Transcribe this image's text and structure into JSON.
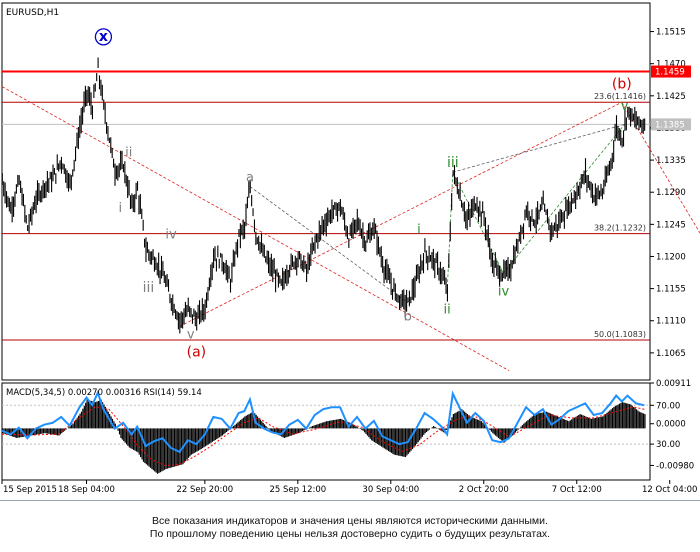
{
  "chart_data": {
    "type": "line",
    "symbol": "EURUSD,H1",
    "price_axis": {
      "ylim": [
        1.1027,
        1.1555
      ],
      "ticks": [
        "1.1515",
        "1.1470",
        "1.1425",
        "1.1380",
        "1.1335",
        "1.1290",
        "1.1245",
        "1.1200",
        "1.1155",
        "1.1110",
        "1.1065"
      ],
      "tick_values": [
        1.1515,
        1.147,
        1.1425,
        1.138,
        1.1335,
        1.129,
        1.1245,
        1.12,
        1.1155,
        1.111,
        1.1065
      ],
      "marked_levels": [
        {
          "label": "1.1459",
          "value": 1.1459,
          "color": "#ff0000"
        },
        {
          "label": "1.1385",
          "value": 1.1385,
          "color": "#c0c0c0"
        }
      ]
    },
    "time_axis": {
      "labels": [
        "15 Sep 2015",
        "18 Sep 04:00",
        "22 Sep 20:00",
        "25 Sep 12:00",
        "30 Sep 04:00",
        "2 Oct 20:00",
        "7 Oct 12:00",
        "12 Oct 04:00"
      ],
      "label_bars": [
        0,
        60,
        144,
        210,
        276,
        342,
        408,
        474
      ]
    },
    "price_series": {
      "name": "EURUSD",
      "pivots": [
        [
          0,
          1.1305
        ],
        [
          6,
          1.1265
        ],
        [
          12,
          1.1305
        ],
        [
          18,
          1.124
        ],
        [
          24,
          1.128
        ],
        [
          30,
          1.13
        ],
        [
          36,
          1.131
        ],
        [
          42,
          1.1335
        ],
        [
          48,
          1.13
        ],
        [
          55,
          1.138
        ],
        [
          60,
          1.143
        ],
        [
          64,
          1.1408
        ],
        [
          68,
          1.1462
        ],
        [
          72,
          1.141
        ],
        [
          76,
          1.1365
        ],
        [
          80,
          1.132
        ],
        [
          86,
          1.1328
        ],
        [
          92,
          1.127
        ],
        [
          96,
          1.1295
        ],
        [
          102,
          1.121
        ],
        [
          108,
          1.1195
        ],
        [
          114,
          1.1175
        ],
        [
          120,
          1.114
        ],
        [
          126,
          1.111
        ],
        [
          132,
          1.1125
        ],
        [
          138,
          1.1112
        ],
        [
          144,
          1.1128
        ],
        [
          150,
          1.12
        ],
        [
          156,
          1.1195
        ],
        [
          162,
          1.1165
        ],
        [
          168,
          1.123
        ],
        [
          172,
          1.124
        ],
        [
          176,
          1.1298
        ],
        [
          180,
          1.1232
        ],
        [
          186,
          1.12
        ],
        [
          192,
          1.118
        ],
        [
          198,
          1.116
        ],
        [
          204,
          1.1185
        ],
        [
          210,
          1.12
        ],
        [
          216,
          1.118
        ],
        [
          222,
          1.122
        ],
        [
          228,
          1.1245
        ],
        [
          234,
          1.1262
        ],
        [
          240,
          1.127
        ],
        [
          246,
          1.1225
        ],
        [
          252,
          1.125
        ],
        [
          258,
          1.122
        ],
        [
          264,
          1.124
        ],
        [
          270,
          1.119
        ],
        [
          276,
          1.116
        ],
        [
          282,
          1.114
        ],
        [
          288,
          1.1135
        ],
        [
          294,
          1.1165
        ],
        [
          300,
          1.1205
        ],
        [
          306,
          1.1195
        ],
        [
          312,
          1.1175
        ],
        [
          316,
          1.115
        ],
        [
          320,
          1.1318
        ],
        [
          324,
          1.1292
        ],
        [
          330,
          1.125
        ],
        [
          336,
          1.1275
        ],
        [
          342,
          1.1255
        ],
        [
          348,
          1.119
        ],
        [
          354,
          1.1175
        ],
        [
          360,
          1.118
        ],
        [
          366,
          1.1215
        ],
        [
          372,
          1.1265
        ],
        [
          378,
          1.125
        ],
        [
          384,
          1.127
        ],
        [
          390,
          1.1235
        ],
        [
          396,
          1.125
        ],
        [
          402,
          1.127
        ],
        [
          408,
          1.129
        ],
        [
          414,
          1.1315
        ],
        [
          420,
          1.1285
        ],
        [
          426,
          1.129
        ],
        [
          432,
          1.133
        ],
        [
          436,
          1.138
        ],
        [
          440,
          1.1365
        ],
        [
          444,
          1.1405
        ],
        [
          450,
          1.1388
        ],
        [
          456,
          1.1385
        ]
      ]
    },
    "fib_levels": [
      {
        "label": "23.6(1.1416)",
        "value": 1.1416,
        "color": "#b30000"
      },
      {
        "label": "38.2(1.1232)",
        "value": 1.1232,
        "color": "#b30000"
      },
      {
        "label": "50.0(1.1083)",
        "value": 1.1083,
        "color": "#b30000"
      }
    ],
    "wave_labels": [
      {
        "text": "x",
        "bar": 72,
        "price": 1.1502,
        "color": "#0000cc",
        "circled": true
      },
      {
        "text": "ii",
        "bar": 90,
        "price": 1.134,
        "color": "#808080"
      },
      {
        "text": "i",
        "bar": 84,
        "price": 1.1262,
        "color": "#808080"
      },
      {
        "text": "iv",
        "bar": 120,
        "price": 1.1225,
        "color": "#808080"
      },
      {
        "text": "iii",
        "bar": 104,
        "price": 1.115,
        "color": "#808080"
      },
      {
        "text": "v",
        "bar": 134,
        "price": 1.1085,
        "color": "#808080"
      },
      {
        "text": "(a)",
        "bar": 138,
        "price": 1.106,
        "color": "#cc0000"
      },
      {
        "text": "a",
        "bar": 176,
        "price": 1.1305,
        "color": "#808080"
      },
      {
        "text": "b",
        "bar": 288,
        "price": 1.111,
        "color": "#808080"
      },
      {
        "text": "i",
        "bar": 296,
        "price": 1.1232,
        "color": "#2e8b2e"
      },
      {
        "text": "ii",
        "bar": 316,
        "price": 1.112,
        "color": "#2e8b2e"
      },
      {
        "text": "iii",
        "bar": 320,
        "price": 1.1325,
        "color": "#2e8b2e"
      },
      {
        "text": "iv",
        "bar": 356,
        "price": 1.1145,
        "color": "#2e8b2e"
      },
      {
        "text": "v",
        "bar": 442,
        "price": 1.1405,
        "color": "#2e8b2e"
      },
      {
        "text": "(b)",
        "bar": 440,
        "price": 1.1435,
        "color": "#cc0000"
      }
    ],
    "indicator": {
      "label": "MACD(5,34,5) 0.00270 0.00316 RSI(14) 59.14",
      "ticks": [
        "0.00911",
        "70.00",
        "0.0000",
        "30.00",
        "-0.00980"
      ],
      "tick_positions": [
        0.0,
        0.23,
        0.42,
        0.63,
        0.85
      ],
      "ylim": [
        -0.0108,
        0.0095
      ],
      "histogram": [
        [
          0,
          -0.001
        ],
        [
          10,
          -0.002
        ],
        [
          20,
          -0.0015
        ],
        [
          30,
          -0.001
        ],
        [
          40,
          -0.0015
        ],
        [
          50,
          0.001
        ],
        [
          56,
          0.0035
        ],
        [
          60,
          0.006
        ],
        [
          66,
          0.0055
        ],
        [
          70,
          0.006
        ],
        [
          74,
          0.004
        ],
        [
          80,
          0.001
        ],
        [
          84,
          -0.002
        ],
        [
          90,
          -0.004
        ],
        [
          96,
          -0.005
        ],
        [
          100,
          -0.007
        ],
        [
          106,
          -0.0085
        ],
        [
          110,
          -0.0095
        ],
        [
          116,
          -0.0085
        ],
        [
          122,
          -0.008
        ],
        [
          128,
          -0.0075
        ],
        [
          134,
          -0.0055
        ],
        [
          140,
          -0.0045
        ],
        [
          148,
          -0.003
        ],
        [
          156,
          -0.0015
        ],
        [
          164,
          0.0005
        ],
        [
          172,
          0.0025
        ],
        [
          178,
          0.0035
        ],
        [
          184,
          0.0015
        ],
        [
          190,
          -0.0005
        ],
        [
          200,
          -0.002
        ],
        [
          210,
          -0.001
        ],
        [
          220,
          0.0005
        ],
        [
          230,
          0.0015
        ],
        [
          240,
          0.002
        ],
        [
          248,
          0.001
        ],
        [
          256,
          -0.0005
        ],
        [
          262,
          -0.0025
        ],
        [
          270,
          -0.004
        ],
        [
          278,
          -0.0055
        ],
        [
          286,
          -0.006
        ],
        [
          292,
          -0.004
        ],
        [
          300,
          -0.001
        ],
        [
          306,
          0.0005
        ],
        [
          314,
          -0.001
        ],
        [
          320,
          0.003
        ],
        [
          326,
          0.004
        ],
        [
          332,
          0.0025
        ],
        [
          340,
          0.0015
        ],
        [
          348,
          -0.001
        ],
        [
          356,
          -0.003
        ],
        [
          362,
          -0.0015
        ],
        [
          370,
          0.001
        ],
        [
          378,
          0.003
        ],
        [
          386,
          0.0035
        ],
        [
          394,
          0.0025
        ],
        [
          402,
          0.0015
        ],
        [
          410,
          0.003
        ],
        [
          418,
          0.002
        ],
        [
          426,
          0.0025
        ],
        [
          434,
          0.0045
        ],
        [
          440,
          0.0055
        ],
        [
          446,
          0.005
        ],
        [
          452,
          0.0035
        ],
        [
          456,
          0.003
        ]
      ],
      "signal": [
        [
          0,
          -0.0012
        ],
        [
          20,
          -0.0014
        ],
        [
          40,
          -0.0012
        ],
        [
          56,
          0.0025
        ],
        [
          66,
          0.0045
        ],
        [
          76,
          0.004
        ],
        [
          86,
          0.0005
        ],
        [
          96,
          -0.0035
        ],
        [
          106,
          -0.0065
        ],
        [
          116,
          -0.0078
        ],
        [
          126,
          -0.0075
        ],
        [
          136,
          -0.006
        ],
        [
          148,
          -0.0038
        ],
        [
          160,
          -0.0012
        ],
        [
          172,
          0.0012
        ],
        [
          182,
          0.0022
        ],
        [
          192,
          0.0004
        ],
        [
          206,
          -0.0012
        ],
        [
          222,
          -0.0002
        ],
        [
          240,
          0.0014
        ],
        [
          256,
          0.0002
        ],
        [
          270,
          -0.0028
        ],
        [
          284,
          -0.0048
        ],
        [
          296,
          -0.0035
        ],
        [
          308,
          -0.0008
        ],
        [
          322,
          0.0018
        ],
        [
          334,
          0.0028
        ],
        [
          348,
          0.0005
        ],
        [
          360,
          -0.0018
        ],
        [
          374,
          0.0005
        ],
        [
          388,
          0.0028
        ],
        [
          404,
          0.0022
        ],
        [
          420,
          0.0022
        ],
        [
          436,
          0.0035
        ],
        [
          448,
          0.0045
        ],
        [
          456,
          0.004
        ]
      ],
      "rsi": [
        [
          0,
          44
        ],
        [
          6,
          40
        ],
        [
          12,
          47
        ],
        [
          18,
          36
        ],
        [
          24,
          46
        ],
        [
          30,
          50
        ],
        [
          36,
          52
        ],
        [
          42,
          58
        ],
        [
          48,
          49
        ],
        [
          55,
          68
        ],
        [
          60,
          78
        ],
        [
          64,
          70
        ],
        [
          68,
          83
        ],
        [
          72,
          66
        ],
        [
          76,
          56
        ],
        [
          80,
          46
        ],
        [
          86,
          52
        ],
        [
          92,
          40
        ],
        [
          96,
          48
        ],
        [
          102,
          28
        ],
        [
          108,
          33
        ],
        [
          114,
          36
        ],
        [
          120,
          26
        ],
        [
          126,
          22
        ],
        [
          132,
          34
        ],
        [
          138,
          30
        ],
        [
          144,
          40
        ],
        [
          150,
          58
        ],
        [
          156,
          56
        ],
        [
          162,
          46
        ],
        [
          168,
          62
        ],
        [
          172,
          64
        ],
        [
          176,
          76
        ],
        [
          180,
          52
        ],
        [
          186,
          46
        ],
        [
          192,
          42
        ],
        [
          198,
          40
        ],
        [
          204,
          50
        ],
        [
          210,
          55
        ],
        [
          216,
          46
        ],
        [
          222,
          60
        ],
        [
          228,
          66
        ],
        [
          234,
          68
        ],
        [
          240,
          68
        ],
        [
          246,
          48
        ],
        [
          252,
          58
        ],
        [
          258,
          46
        ],
        [
          264,
          54
        ],
        [
          270,
          38
        ],
        [
          276,
          34
        ],
        [
          282,
          30
        ],
        [
          288,
          32
        ],
        [
          294,
          46
        ],
        [
          300,
          62
        ],
        [
          306,
          56
        ],
        [
          312,
          48
        ],
        [
          316,
          40
        ],
        [
          320,
          82
        ],
        [
          324,
          70
        ],
        [
          330,
          52
        ],
        [
          336,
          62
        ],
        [
          342,
          54
        ],
        [
          348,
          34
        ],
        [
          354,
          32
        ],
        [
          360,
          36
        ],
        [
          366,
          52
        ],
        [
          372,
          68
        ],
        [
          378,
          60
        ],
        [
          384,
          66
        ],
        [
          390,
          50
        ],
        [
          396,
          56
        ],
        [
          402,
          64
        ],
        [
          408,
          68
        ],
        [
          414,
          72
        ],
        [
          420,
          60
        ],
        [
          426,
          62
        ],
        [
          432,
          72
        ],
        [
          436,
          80
        ],
        [
          440,
          74
        ],
        [
          444,
          80
        ],
        [
          450,
          72
        ],
        [
          456,
          70
        ]
      ]
    }
  },
  "footer": {
    "line1": "Все показания индикаторов и значения цены являются историческими данными.",
    "line2": "По прошлому поведению цены нельзя достоверно судить о будущих результатах."
  }
}
